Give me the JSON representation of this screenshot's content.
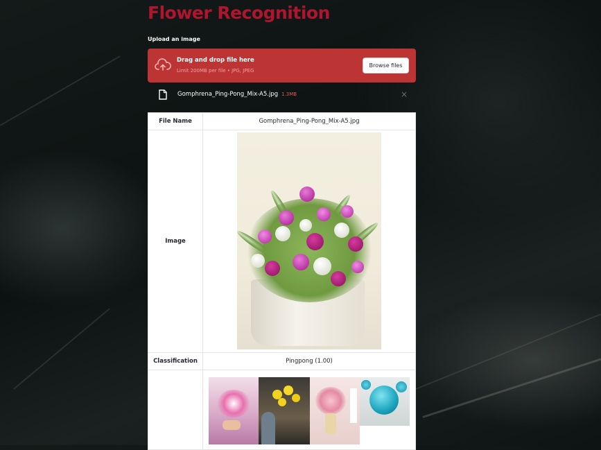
{
  "app": {
    "title": "Flower Recognition"
  },
  "uploader": {
    "label": "Upload an image",
    "drop_title": "Drag and drop file here",
    "drop_sub": "Limit 200MB per file • JPG, JPEG",
    "browse_label": "Browse files",
    "cloud_icon": "cloud-upload-icon"
  },
  "file": {
    "name": "Gomphrena_Ping-Pong_Mix-A5.jpg",
    "size": "1.3MB",
    "close": "×",
    "icon": "file-icon"
  },
  "table": {
    "rows": [
      {
        "label": "File Name",
        "value": "Gomphrena_Ping-Pong_Mix-A5.jpg"
      },
      {
        "label": "Image"
      },
      {
        "label": "Classification",
        "value": "Pingpong (1.00)"
      },
      {
        "label": ""
      }
    ]
  },
  "colors": {
    "title": "#b0152f",
    "dropzone": "#bd3434",
    "file_size": "#e05a5a"
  }
}
